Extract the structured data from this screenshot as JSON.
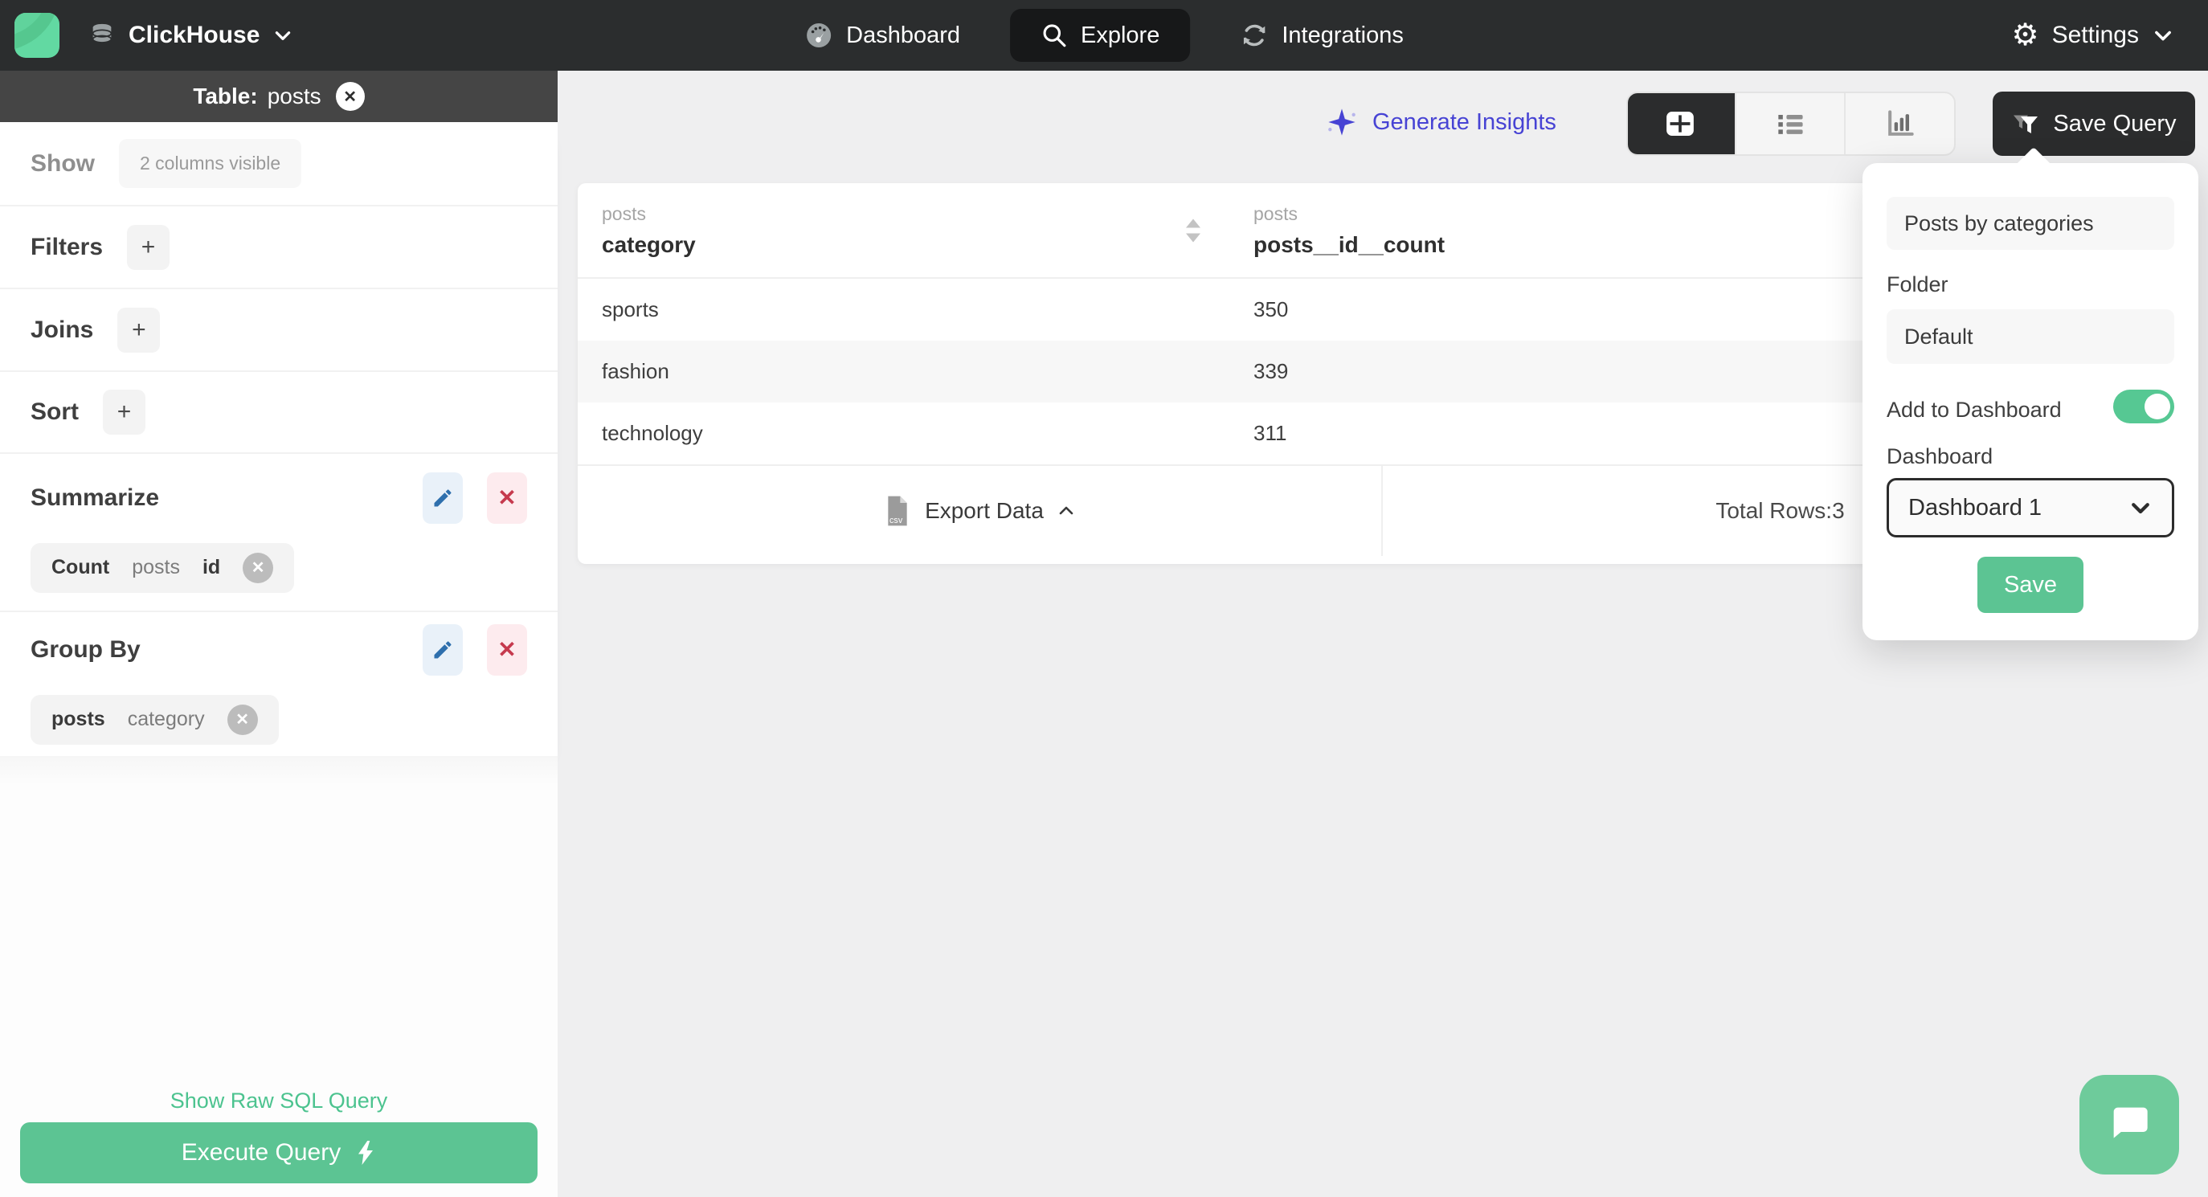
{
  "topnav": {
    "brand_name": "ClickHouse",
    "items": [
      {
        "label": "Dashboard",
        "active": false
      },
      {
        "label": "Explore",
        "active": true
      },
      {
        "label": "Integrations",
        "active": false
      }
    ],
    "settings_label": "Settings",
    "gear_glyph": "⚙"
  },
  "sidebar": {
    "table_header": {
      "prefix": "Table:",
      "table_name": "posts",
      "close_glyph": "✕"
    },
    "show": {
      "label": "Show",
      "control": "2 columns visible"
    },
    "filters": {
      "label": "Filters",
      "add": "+"
    },
    "joins": {
      "label": "Joins",
      "add": "+"
    },
    "sort": {
      "label": "Sort",
      "add": "+"
    },
    "summarize": {
      "label": "Summarize",
      "chip": {
        "agg": "Count",
        "table": "posts",
        "field": "id",
        "remove_glyph": "✕"
      },
      "delete_glyph": "✕"
    },
    "group_by": {
      "label": "Group By",
      "chip": {
        "table": "posts",
        "field": "category",
        "remove_glyph": "✕"
      },
      "delete_glyph": "✕"
    },
    "raw_sql_link": "Show Raw SQL Query",
    "execute_button": "Execute Query"
  },
  "main": {
    "generate_insights": "Generate Insights",
    "save_query_label": "Save Query",
    "table": {
      "columns": [
        {
          "group": "posts",
          "name": "category"
        },
        {
          "group": "posts",
          "name": "posts__id__count"
        }
      ],
      "rows": [
        [
          "sports",
          "350"
        ],
        [
          "fashion",
          "339"
        ],
        [
          "technology",
          "311"
        ]
      ],
      "export_label": "Export Data",
      "export_format": "csv",
      "total_rows_label": "Total Rows:",
      "total_rows_value": "3"
    }
  },
  "popover": {
    "name_value": "Posts by categories",
    "folder_label": "Folder",
    "folder_value": "Default",
    "add_to_dashboard_label": "Add to Dashboard",
    "add_to_dashboard_on": true,
    "dashboard_label": "Dashboard",
    "dashboard_value": "Dashboard 1",
    "save_label": "Save"
  },
  "colors": {
    "topnav_bg": "#2b2d2e",
    "active_pill": "#171819",
    "sidebar_table_bar": "#454545",
    "primary_green": "#5cc493",
    "toggle_green": "#56c893",
    "link_green": "#4cc38f",
    "logo_green": "#62d9a2",
    "insights_indigo": "#4743d4",
    "edit_blue": "#2e6fad",
    "delete_red": "#c63a4e",
    "main_bg": "#efeff0",
    "zebra_row": "#f7f7f7"
  }
}
